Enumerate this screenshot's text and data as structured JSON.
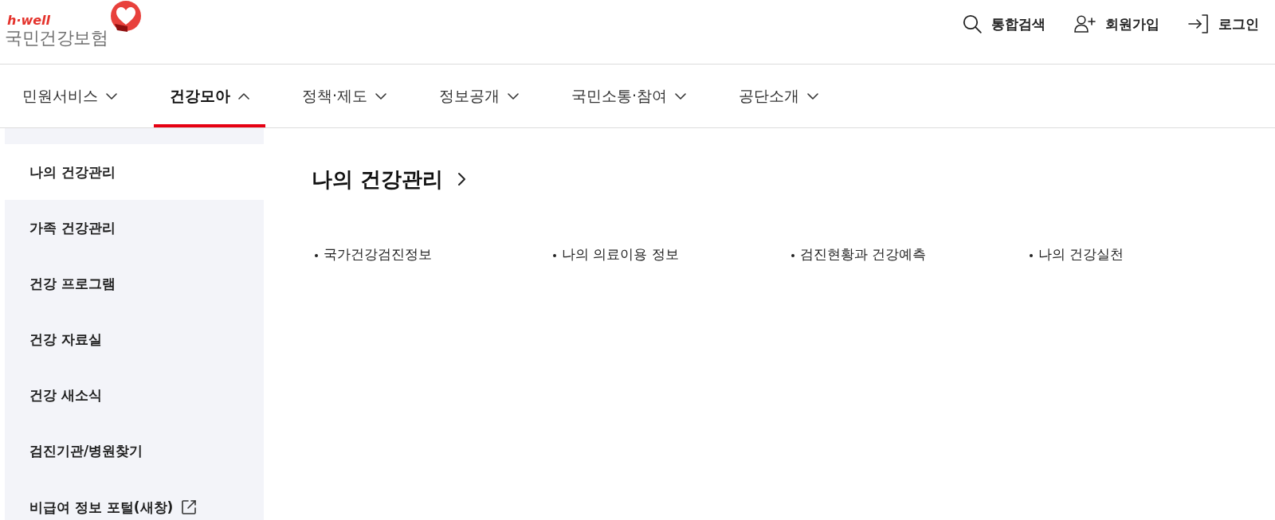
{
  "header": {
    "logo": {
      "tagline": "h·well",
      "name": "국민건강보험"
    },
    "utility_links": [
      {
        "label": "통합검색",
        "kind": "search"
      },
      {
        "label": "회원가입",
        "kind": "signup"
      },
      {
        "label": "로그인",
        "kind": "login"
      }
    ]
  },
  "nav": {
    "items": [
      {
        "label": "민원서비스",
        "selected": false,
        "expanded": false
      },
      {
        "label": "건강모아",
        "selected": true,
        "expanded": true
      },
      {
        "label": "정책·제도",
        "selected": false,
        "expanded": false
      },
      {
        "label": "정보공개",
        "selected": false,
        "expanded": false
      },
      {
        "label": "국민소통·참여",
        "selected": false,
        "expanded": false
      },
      {
        "label": "공단소개",
        "selected": false,
        "expanded": false
      }
    ]
  },
  "sidebar": {
    "items": [
      {
        "label": "나의 건강관리",
        "selected": true,
        "external": false
      },
      {
        "label": "가족 건강관리",
        "selected": false,
        "external": false
      },
      {
        "label": "건강 프로그램",
        "selected": false,
        "external": false
      },
      {
        "label": "건강 자료실",
        "selected": false,
        "external": false
      },
      {
        "label": "건강 새소식",
        "selected": false,
        "external": false
      },
      {
        "label": "검진기관/병원찾기",
        "selected": false,
        "external": false
      },
      {
        "label": "비급여 정보 포털(새창)",
        "selected": false,
        "external": true
      }
    ]
  },
  "content": {
    "title": "나의 건강관리",
    "links": [
      "국가건강검진정보",
      "나의 의료이용 정보",
      "검진현황과 건강예측",
      "나의 건강실천"
    ]
  }
}
